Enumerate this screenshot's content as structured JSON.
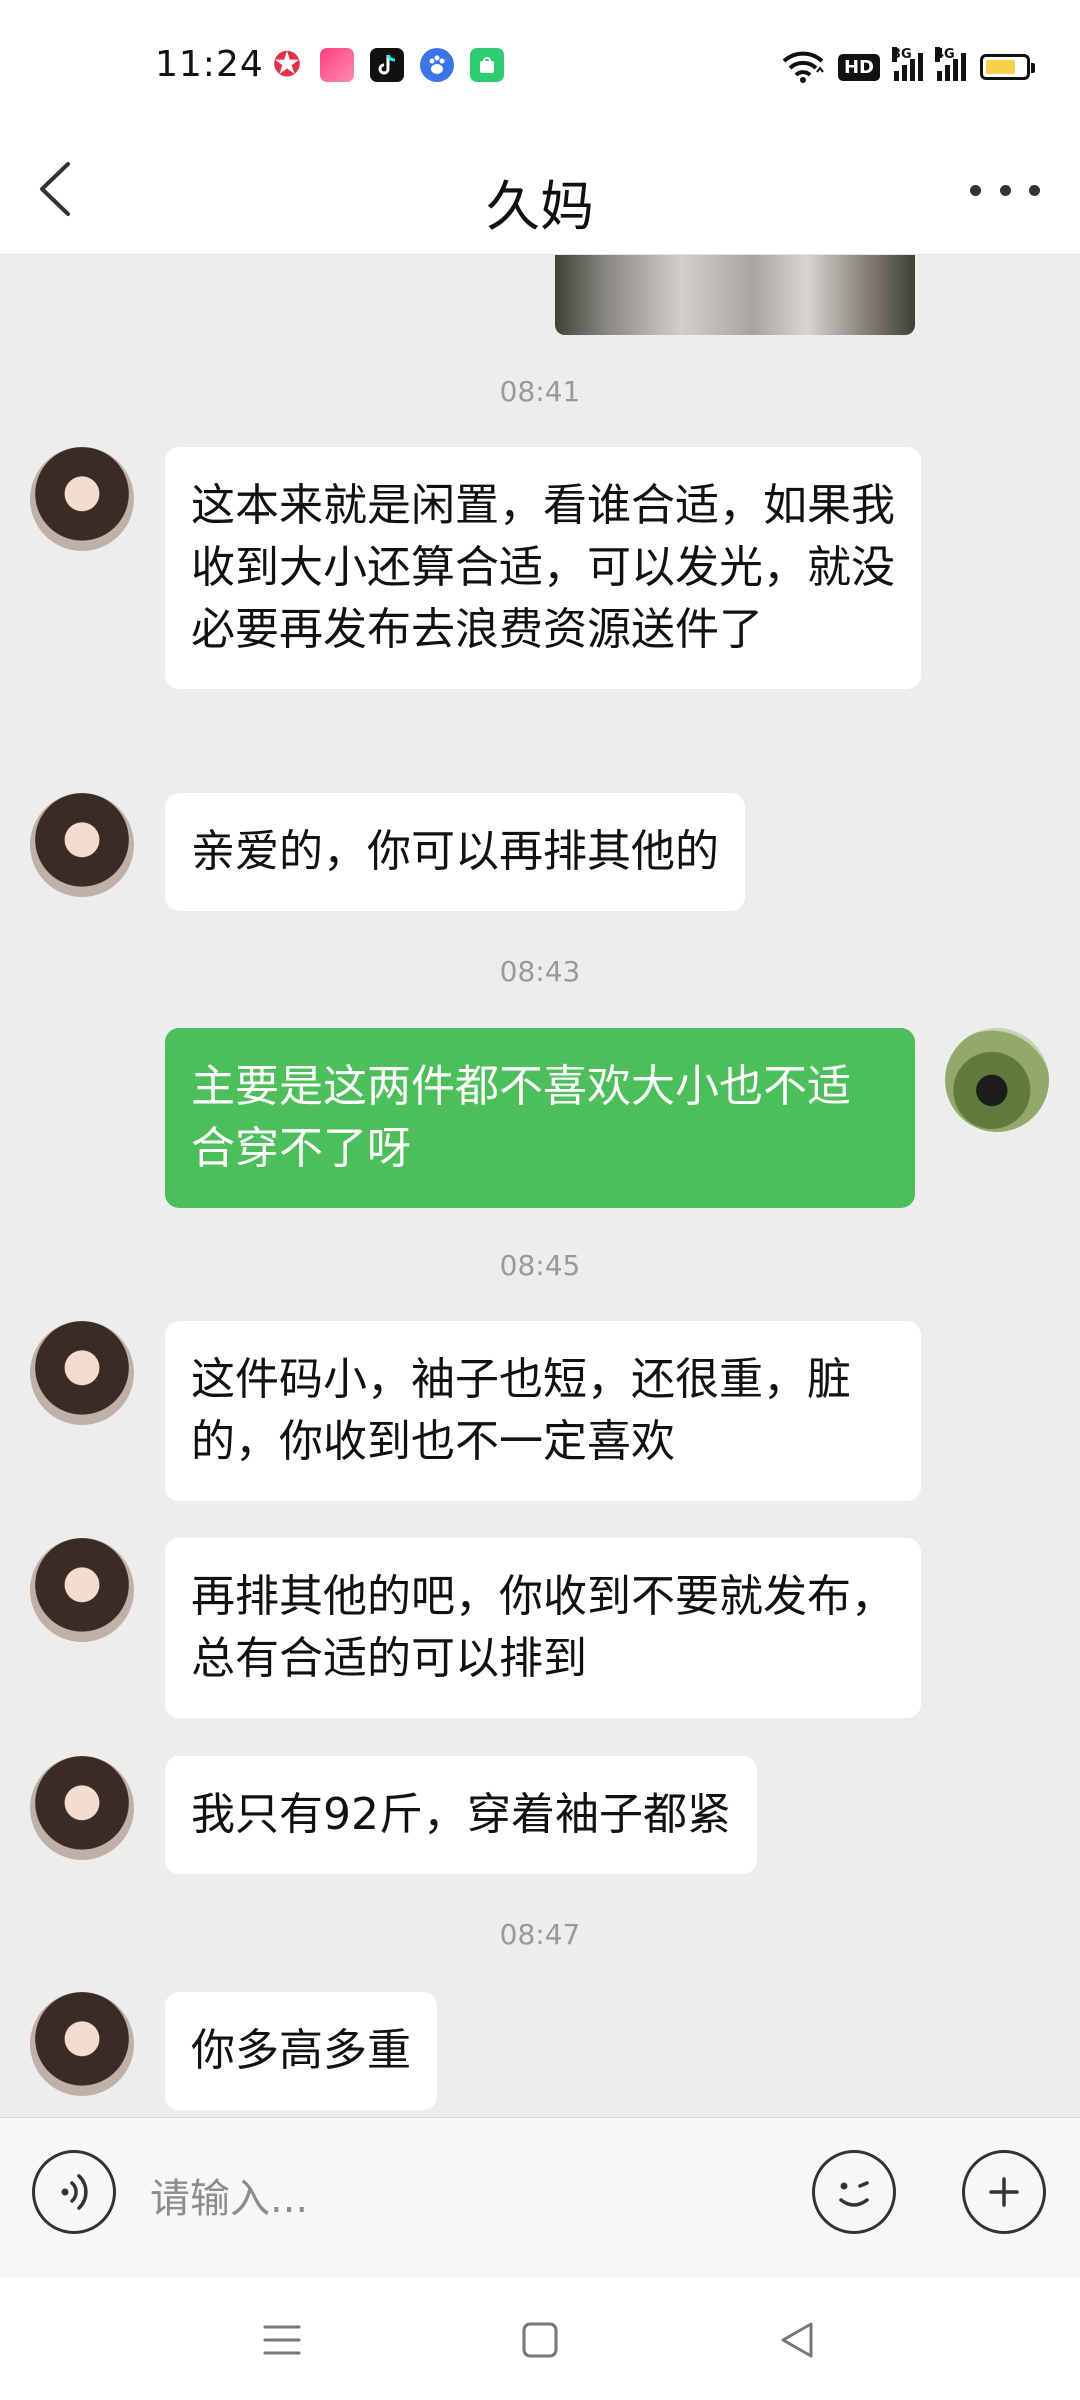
{
  "status_bar": {
    "time": "11:24",
    "notification_icons": [
      "star-app-icon",
      "pink-app-icon",
      "tiktok-icon",
      "baidu-icon",
      "green-store-icon"
    ],
    "hd_label": "HD",
    "signal_1_label": "3G",
    "signal_2_label": "4G",
    "battery_level": 0.75,
    "battery_color": "#f5d24a"
  },
  "nav": {
    "title": "久妈"
  },
  "chat": {
    "messages": [
      {
        "type": "time",
        "text": "08:41"
      },
      {
        "type": "in",
        "text": "这本来就是闲置，看谁合适，如果我收到大小还算合适，可以发光，就没必要再发布去浪费资源送件了"
      },
      {
        "type": "in",
        "text": "亲爱的，你可以再排其他的"
      },
      {
        "type": "time",
        "text": "08:43"
      },
      {
        "type": "out",
        "text": "主要是这两件都不喜欢大小也不适合穿不了呀"
      },
      {
        "type": "time",
        "text": "08:45"
      },
      {
        "type": "in",
        "text": "这件码小，袖子也短，还很重，脏的，你收到也不一定喜欢"
      },
      {
        "type": "in",
        "text": "再排其他的吧，你收到不要就发布，总有合适的可以排到"
      },
      {
        "type": "in",
        "text": "我只有92斤，穿着袖子都紧"
      },
      {
        "type": "time",
        "text": "08:47"
      },
      {
        "type": "in",
        "text": "你多高多重"
      }
    ]
  },
  "input": {
    "placeholder": "请输入..."
  },
  "colors": {
    "outgoing_bubble": "#4cbe5a",
    "incoming_bubble": "#ffffff",
    "chat_background": "#ededed"
  }
}
